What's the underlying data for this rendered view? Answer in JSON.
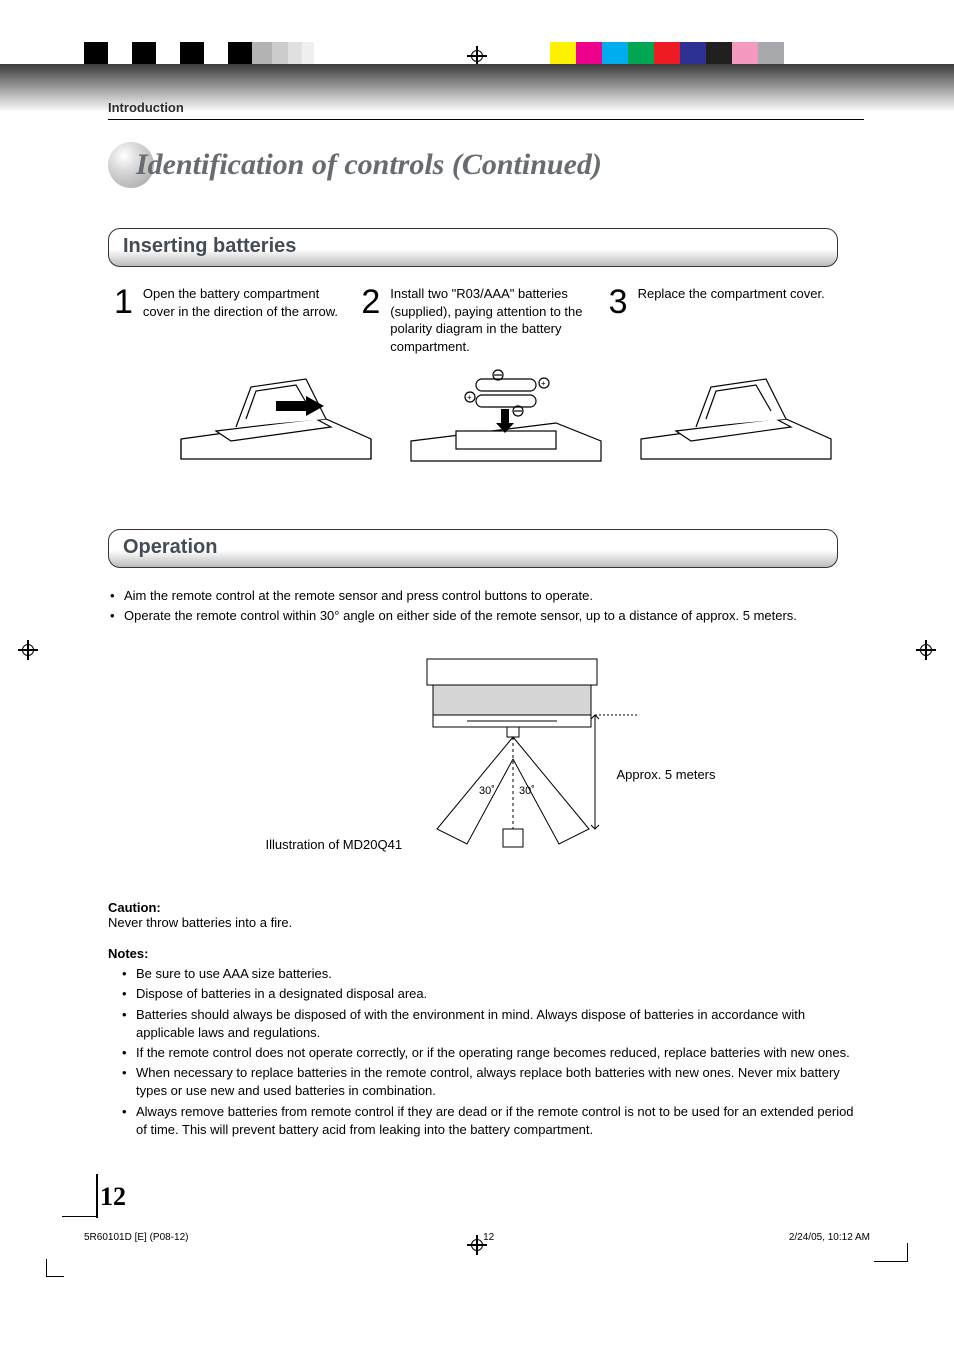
{
  "header": {
    "section": "Introduction",
    "title": "Identification of controls (Continued)"
  },
  "inserting": {
    "heading": "Inserting batteries",
    "step1_text": "Open the battery compartment cover in the direction of the arrow.",
    "step2_text": "Install two \"R03/AAA\" batteries (supplied), paying attention to the polarity diagram in the battery compartment.",
    "step3_text": "Replace the compartment cover.",
    "num1": "1",
    "num2": "2",
    "num3": "3"
  },
  "operation": {
    "heading": "Operation",
    "bullet1": "Aim the remote control at the remote sensor and press control buttons to operate.",
    "bullet2": "Operate the remote control within 30° angle on either side of the remote sensor, up to a distance of approx. 5 meters.",
    "caption": "Illustration of MD20Q41",
    "angle_left": "30˚",
    "angle_right": "30˚",
    "approx": "Approx. 5 meters"
  },
  "caution": {
    "heading": "Caution:",
    "text": "Never throw batteries into a fire."
  },
  "notes": {
    "heading": "Notes:",
    "items": [
      "Be sure to use AAA size batteries.",
      "Dispose of batteries in a designated disposal area.",
      "Batteries should always be disposed of with the environment in mind. Always dispose of batteries in accordance with applicable laws and regulations.",
      "If the remote control does not operate correctly, or if the operating range becomes reduced, replace batteries with new ones.",
      "When necessary to replace batteries in the remote control, always replace both batteries with new ones. Never mix battery types or use new and used batteries in combination.",
      "Always remove batteries from remote control if they are dead or if the remote control is not to be used for an extended period of time. This will prevent battery acid from leaking into the battery compartment."
    ]
  },
  "page": {
    "number": "12"
  },
  "footer": {
    "left": "5R60101D [E] (P08-12)",
    "center": "12",
    "right": "2/24/05, 10:12 AM"
  }
}
